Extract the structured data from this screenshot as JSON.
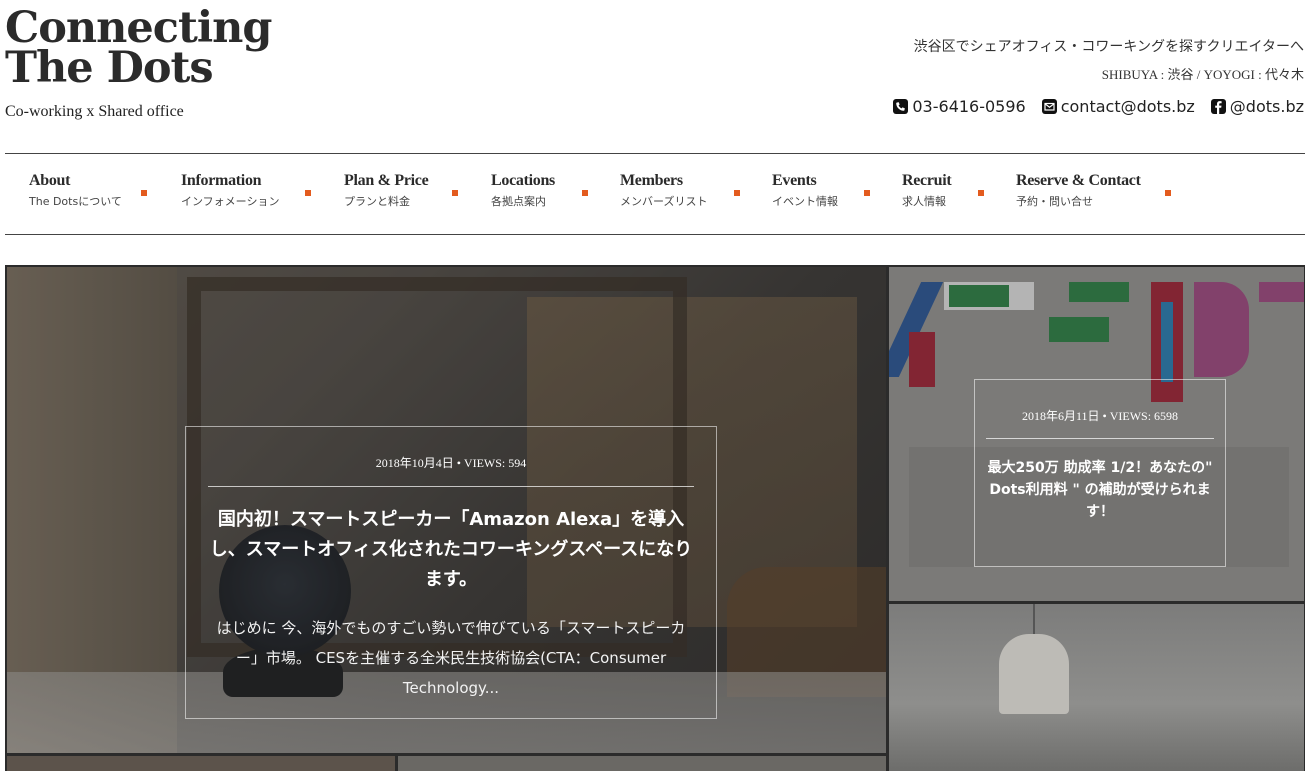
{
  "header": {
    "logo_line1": "Connecting",
    "logo_line2": "The Dots",
    "tagline": "Co-working x Shared office",
    "right_line1": "渋谷区でシェアオフィス・コワーキングを探すクリエイターへ",
    "right_line2": "SHIBUYA : 渋谷 / YOYOGI : 代々木",
    "phone": "03-6416-0596",
    "email": "contact@dots.bz",
    "facebook": "@dots.bz",
    "phone_icon": "phone-icon",
    "email_icon": "envelope-icon",
    "facebook_icon": "facebook-icon"
  },
  "nav": {
    "items": [
      {
        "en": "About",
        "ja": "The Dotsについて"
      },
      {
        "en": "Information",
        "ja": "インフォメーション"
      },
      {
        "en": "Plan & Price",
        "ja": "プランと料金"
      },
      {
        "en": "Locations",
        "ja": "各拠点案内"
      },
      {
        "en": "Members",
        "ja": "メンバーズリスト"
      },
      {
        "en": "Events",
        "ja": "イベント情報"
      },
      {
        "en": "Recruit",
        "ja": "求人情報"
      },
      {
        "en": "Reserve & Contact",
        "ja": "予約・問い合せ"
      }
    ],
    "accent_color": "#e35b1e"
  },
  "posts": {
    "main": {
      "meta": "2018年10月4日 • VIEWS: 594",
      "title": "国内初！スマートスピーカー「Amazon Alexa」を導入し、スマートオフィス化されたコワーキングスペースになります。",
      "excerpt": "はじめに 今、海外でものすごい勢いで伸びている「スマートスピーカー」市場。 CESを主催する全米民生技術協会(CTA：Consumer Technology..."
    },
    "side": {
      "meta": "2018年6月11日 • VIEWS: 6598",
      "title": "最大250万 助成率 1/2！あなたの\" Dots利用料 \" の補助が受けられます！"
    }
  }
}
